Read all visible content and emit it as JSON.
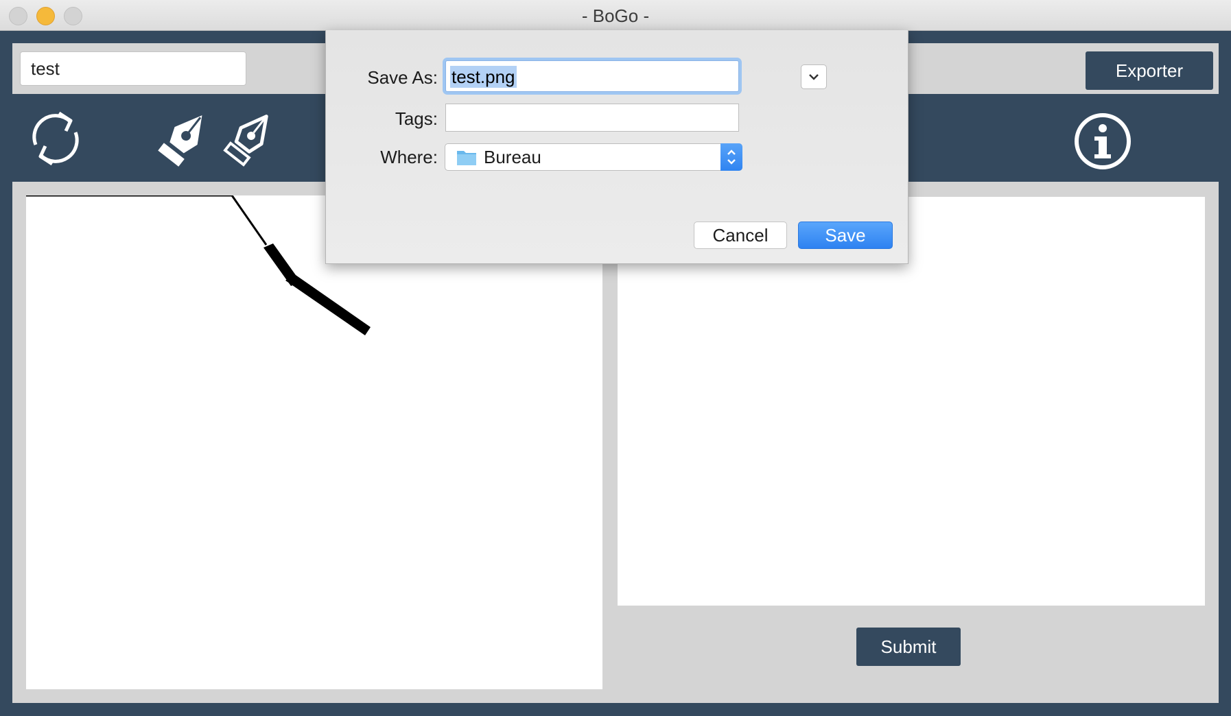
{
  "window": {
    "title": "- BoGo -"
  },
  "topbar": {
    "name_value": "test",
    "export_label": "Exporter"
  },
  "toolbar": {
    "icons": [
      "refresh-icon",
      "pen-nib-filled-icon",
      "pen-nib-outline-icon",
      "info-icon"
    ]
  },
  "main": {
    "submit_label": "Submit"
  },
  "save_dialog": {
    "save_as_label": "Save As:",
    "save_as_value": "test.png",
    "tags_label": "Tags:",
    "tags_value": "",
    "where_label": "Where:",
    "where_value": "Bureau",
    "where_icon": "folder-icon",
    "cancel_label": "Cancel",
    "save_label": "Save"
  },
  "colors": {
    "app_dark": "#34495e",
    "panel_gray": "#d4d4d4",
    "dialog_accent": "#2f84f1",
    "minimize_yellow": "#f5b93a"
  }
}
